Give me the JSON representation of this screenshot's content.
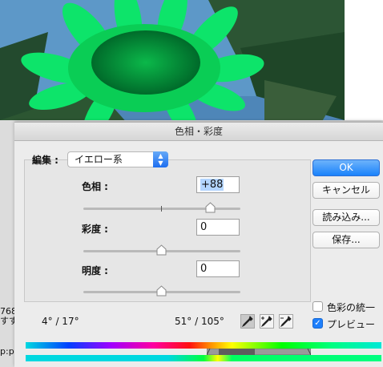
{
  "background": {
    "left_text": [
      "768",
      "すす",
      "p:p"
    ]
  },
  "dialog": {
    "title": "色相・彩度",
    "edit_label": "編集 :",
    "edit_value": "イエロー系",
    "hue": {
      "label": "色相 :",
      "value": "+88",
      "slider_position": 0.82
    },
    "saturation": {
      "label": "彩度 :",
      "value": "0",
      "slider_position": 0.5
    },
    "lightness": {
      "label": "明度 :",
      "value": "0",
      "slider_position": 0.5
    },
    "buttons": {
      "ok": "OK",
      "cancel": "キャンセル",
      "load": "読み込み...",
      "save": "保存..."
    },
    "colorize": {
      "label": "色彩の統一",
      "checked": false
    },
    "preview": {
      "label": "プレビュー",
      "checked": true
    },
    "range_left": "4° / 17°",
    "range_right": "51° / 105°",
    "eyedroppers": [
      "eyedropper-icon",
      "eyedropper-plus-icon",
      "eyedropper-minus-icon"
    ]
  },
  "colors": {
    "ok_button": "#1a82fb",
    "leaf_green": "#00e060",
    "sky": "#4d8dc2"
  }
}
